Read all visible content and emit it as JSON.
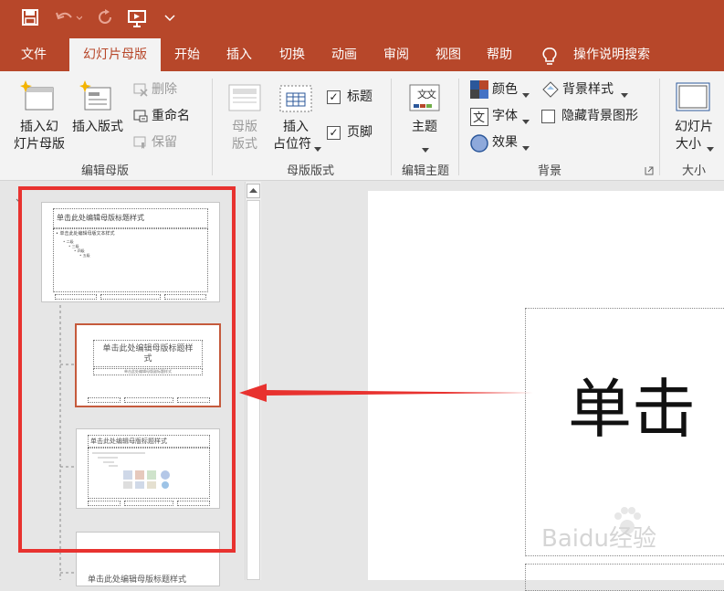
{
  "tabs": {
    "file": "文件",
    "slide_master": "幻灯片母版",
    "home": "开始",
    "insert": "插入",
    "transitions": "切换",
    "animations": "动画",
    "review": "审阅",
    "view": "视图",
    "help": "帮助",
    "tell_me": "操作说明搜索"
  },
  "ribbon": {
    "edit_master": {
      "insert_slide_master_1": "插入幻",
      "insert_slide_master_2": "灯片母版",
      "insert_layout": "插入版式",
      "delete": "删除",
      "rename": "重命名",
      "preserve": "保留",
      "group_label": "编辑母版"
    },
    "master_layout": {
      "master_layout_1": "母版",
      "master_layout_2": "版式",
      "insert_placeholder_1": "插入",
      "insert_placeholder_2": "占位符",
      "title_checkbox": "标题",
      "footer_checkbox": "页脚",
      "group_label": "母版版式"
    },
    "edit_theme": {
      "themes": "主题",
      "group_label": "编辑主题"
    },
    "background": {
      "colors": "颜色",
      "fonts": "字体",
      "effects": "效果",
      "background_styles": "背景样式",
      "hide_background_graphics": "隐藏背景图形",
      "group_label": "背景"
    },
    "size": {
      "slide_size_1": "幻灯片",
      "slide_size_2": "大小",
      "group_label": "大小"
    }
  },
  "thumbnails": {
    "master_title": "单击此处编辑母版标题样式",
    "master_text": "• 单击此处编辑母版文本样式",
    "level2": "• 二级",
    "level3": "• 三级",
    "level4": "• 四级",
    "level5": "• 五级",
    "layout1_title_1": "单击此处编辑母版标题样",
    "layout1_title_2": "式",
    "layout1_subtitle": "单击此处编辑母版副标题样式",
    "layout2_title": "单击此处编辑母版标题样式",
    "layout3_title": "单击此处编辑母版标题样式"
  },
  "slide": {
    "title_text": "单击"
  },
  "watermark": "Baidu经验",
  "colors": {
    "brand": "#b7472a",
    "highlight_box": "#e8322f",
    "arrow": "#e8322f"
  }
}
